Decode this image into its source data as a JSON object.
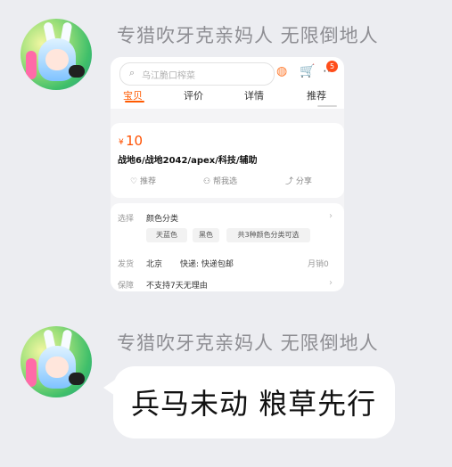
{
  "messages": [
    {
      "sender": "专猎吹牙克亲妈人 无限倒地人",
      "avatar_icon": "anime-bunny-girl-avatar",
      "type": "product-card",
      "card": {
        "search_placeholder": "乌江脆口榨菜",
        "tabs": [
          "宝贝",
          "评价",
          "详情",
          "推荐"
        ],
        "active_tab": "宝贝",
        "cart_badge": "5",
        "price_currency": "¥",
        "price": "10",
        "title": "战地6/战地2042/apex/科技/辅助",
        "actions": [
          "推荐",
          "帮我选",
          "分享"
        ],
        "select_label": "选择",
        "select_value": "颜色分类",
        "options": [
          "天蓝色",
          "黑色",
          "共3种颜色分类可选"
        ],
        "ship_label": "发货",
        "ship_from": "北京",
        "ship_method": "快递: 快递包邮",
        "sales": "月销0",
        "guarantee_label": "保障",
        "guarantee_value": "不支持7天无理由"
      }
    },
    {
      "sender": "专猎吹牙克亲妈人 无限倒地人",
      "avatar_icon": "anime-bunny-girl-avatar",
      "type": "text",
      "text": "兵马未动 粮草先行"
    }
  ],
  "colors": {
    "accent": "#ff5000",
    "background": "#ecedf1"
  }
}
